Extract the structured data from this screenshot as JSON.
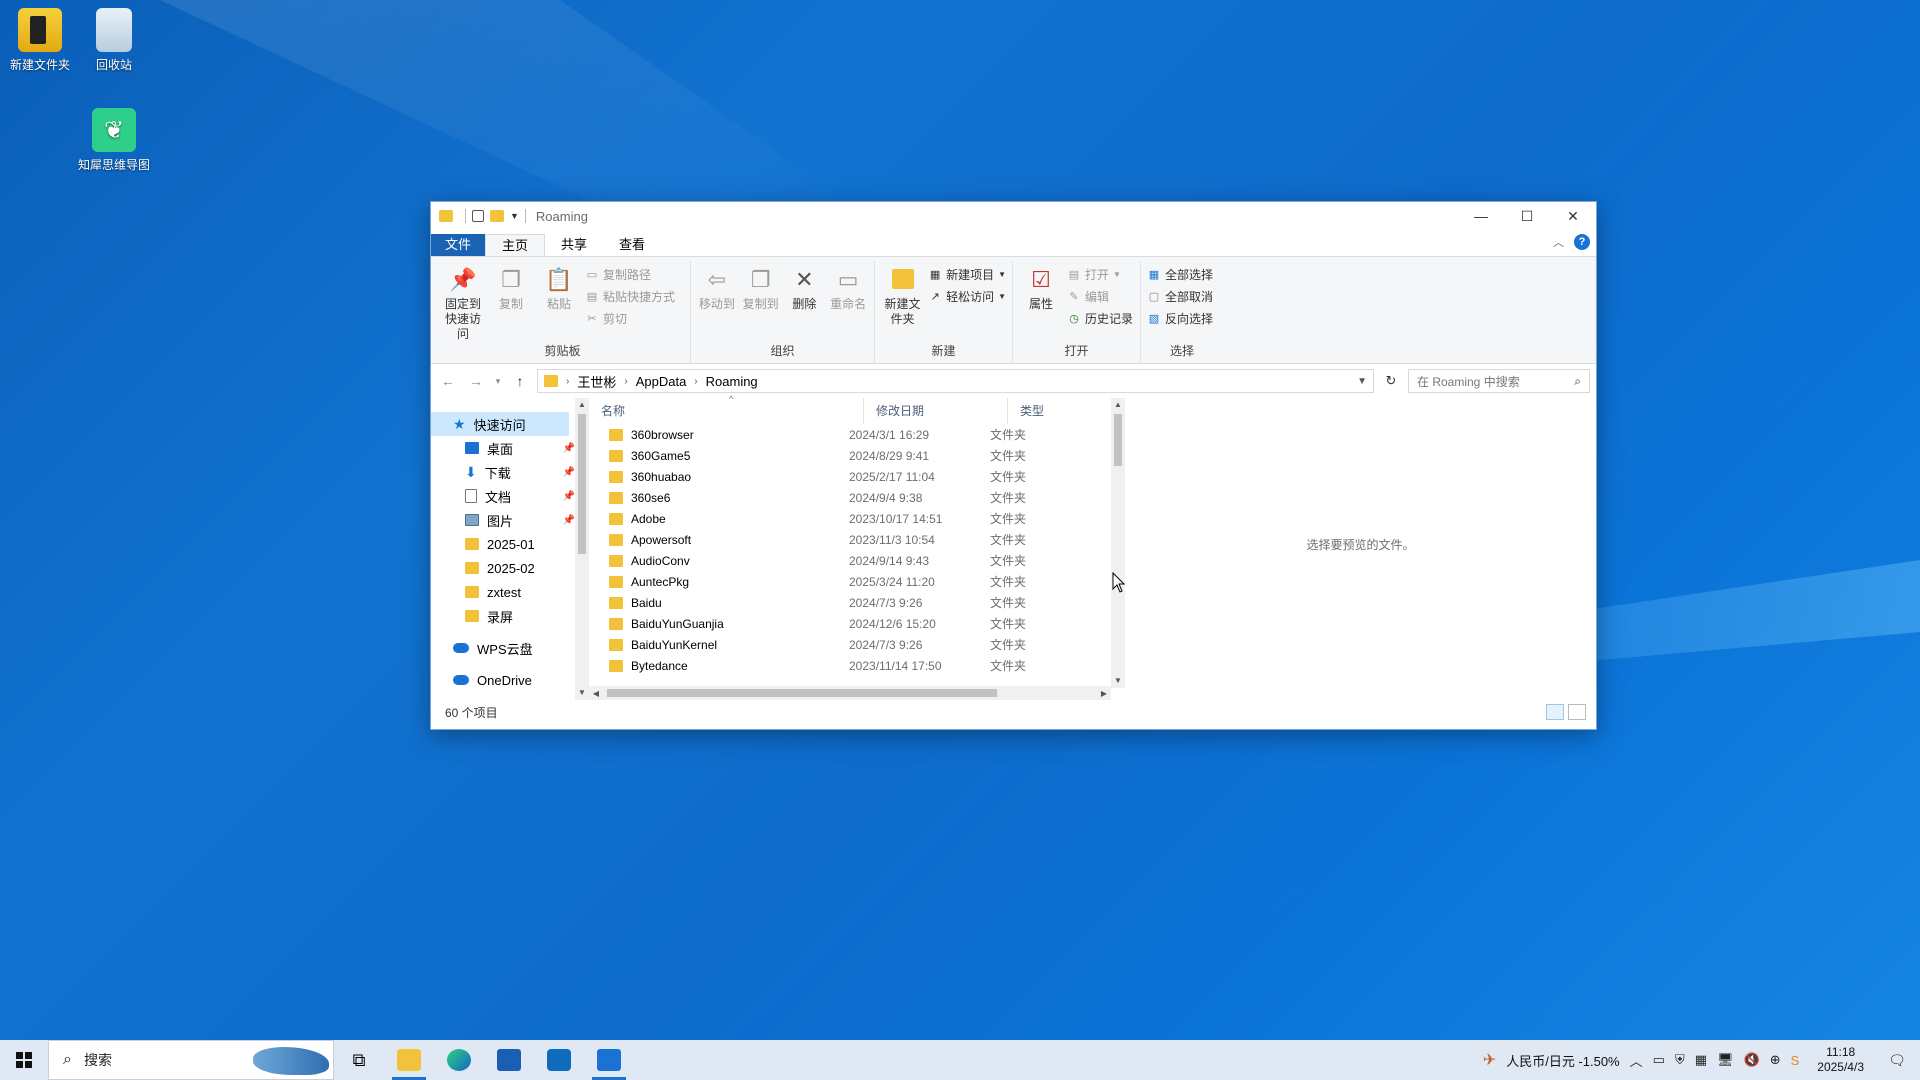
{
  "desktop": {
    "icons": [
      {
        "label": "新建文件夹",
        "icon": "folder-doc-icon"
      },
      {
        "label": "回收站",
        "icon": "recycle-bin-icon"
      },
      {
        "label": "知犀思维导图",
        "icon": "mindmap-app-icon"
      }
    ]
  },
  "window": {
    "title": "Roaming",
    "tabs": [
      "文件",
      "主页",
      "共享",
      "查看"
    ],
    "ribbon": {
      "clipboard": {
        "label": "剪贴板",
        "pin": "固定到快速访问",
        "copy": "复制",
        "paste": "粘贴",
        "copy_path": "复制路径",
        "paste_shortcut": "粘贴快捷方式",
        "cut": "剪切"
      },
      "organize": {
        "label": "组织",
        "move_to": "移动到",
        "copy_to": "复制到",
        "delete": "删除",
        "rename": "重命名"
      },
      "new": {
        "label": "新建",
        "new_folder": "新建文件夹",
        "new_item": "新建项目",
        "easy_access": "轻松访问"
      },
      "open": {
        "label": "打开",
        "properties": "属性",
        "open": "打开",
        "edit": "编辑",
        "history": "历史记录"
      },
      "select": {
        "label": "选择",
        "select_all": "全部选择",
        "select_none": "全部取消",
        "invert": "反向选择"
      }
    },
    "address": {
      "crumbs": [
        "王世彬",
        "AppData",
        "Roaming"
      ],
      "search_placeholder": "在 Roaming 中搜索"
    },
    "nav": {
      "quick_access": "快速访问",
      "pinned": [
        {
          "label": "桌面",
          "icon": "desktop-icon"
        },
        {
          "label": "下载",
          "icon": "download-icon"
        },
        {
          "label": "文档",
          "icon": "document-icon"
        },
        {
          "label": "图片",
          "icon": "pictures-icon"
        }
      ],
      "folders": [
        "2025-01",
        "2025-02",
        "zxtest",
        "录屏"
      ],
      "wps": "WPS云盘",
      "onedrive": "OneDrive"
    },
    "columns": {
      "name": "名称",
      "date": "修改日期",
      "type": "类型"
    },
    "files": [
      {
        "name": "360browser",
        "date": "2024/3/1 16:29",
        "type": "文件夹"
      },
      {
        "name": "360Game5",
        "date": "2024/8/29 9:41",
        "type": "文件夹"
      },
      {
        "name": "360huabao",
        "date": "2025/2/17 11:04",
        "type": "文件夹"
      },
      {
        "name": "360se6",
        "date": "2024/9/4 9:38",
        "type": "文件夹"
      },
      {
        "name": "Adobe",
        "date": "2023/10/17 14:51",
        "type": "文件夹"
      },
      {
        "name": "Apowersoft",
        "date": "2023/11/3 10:54",
        "type": "文件夹"
      },
      {
        "name": "AudioConv",
        "date": "2024/9/14 9:43",
        "type": "文件夹"
      },
      {
        "name": "AuntecPkg",
        "date": "2025/3/24 11:20",
        "type": "文件夹"
      },
      {
        "name": "Baidu",
        "date": "2024/7/3 9:26",
        "type": "文件夹"
      },
      {
        "name": "BaiduYunGuanjia",
        "date": "2024/12/6 15:20",
        "type": "文件夹"
      },
      {
        "name": "BaiduYunKernel",
        "date": "2024/7/3 9:26",
        "type": "文件夹"
      },
      {
        "name": "Bytedance",
        "date": "2023/11/14 17:50",
        "type": "文件夹"
      }
    ],
    "preview_text": "选择要预览的文件。",
    "status": "60 个项目"
  },
  "taskbar": {
    "search_label": "搜索",
    "apps": [
      "task-view-icon",
      "file-explorer-icon",
      "edge-icon",
      "store-icon",
      "outlook-icon",
      "mail-app-icon"
    ],
    "ticker": "人民币/日元  -1.50%",
    "time": "11:18",
    "date": "2025/4/3"
  }
}
